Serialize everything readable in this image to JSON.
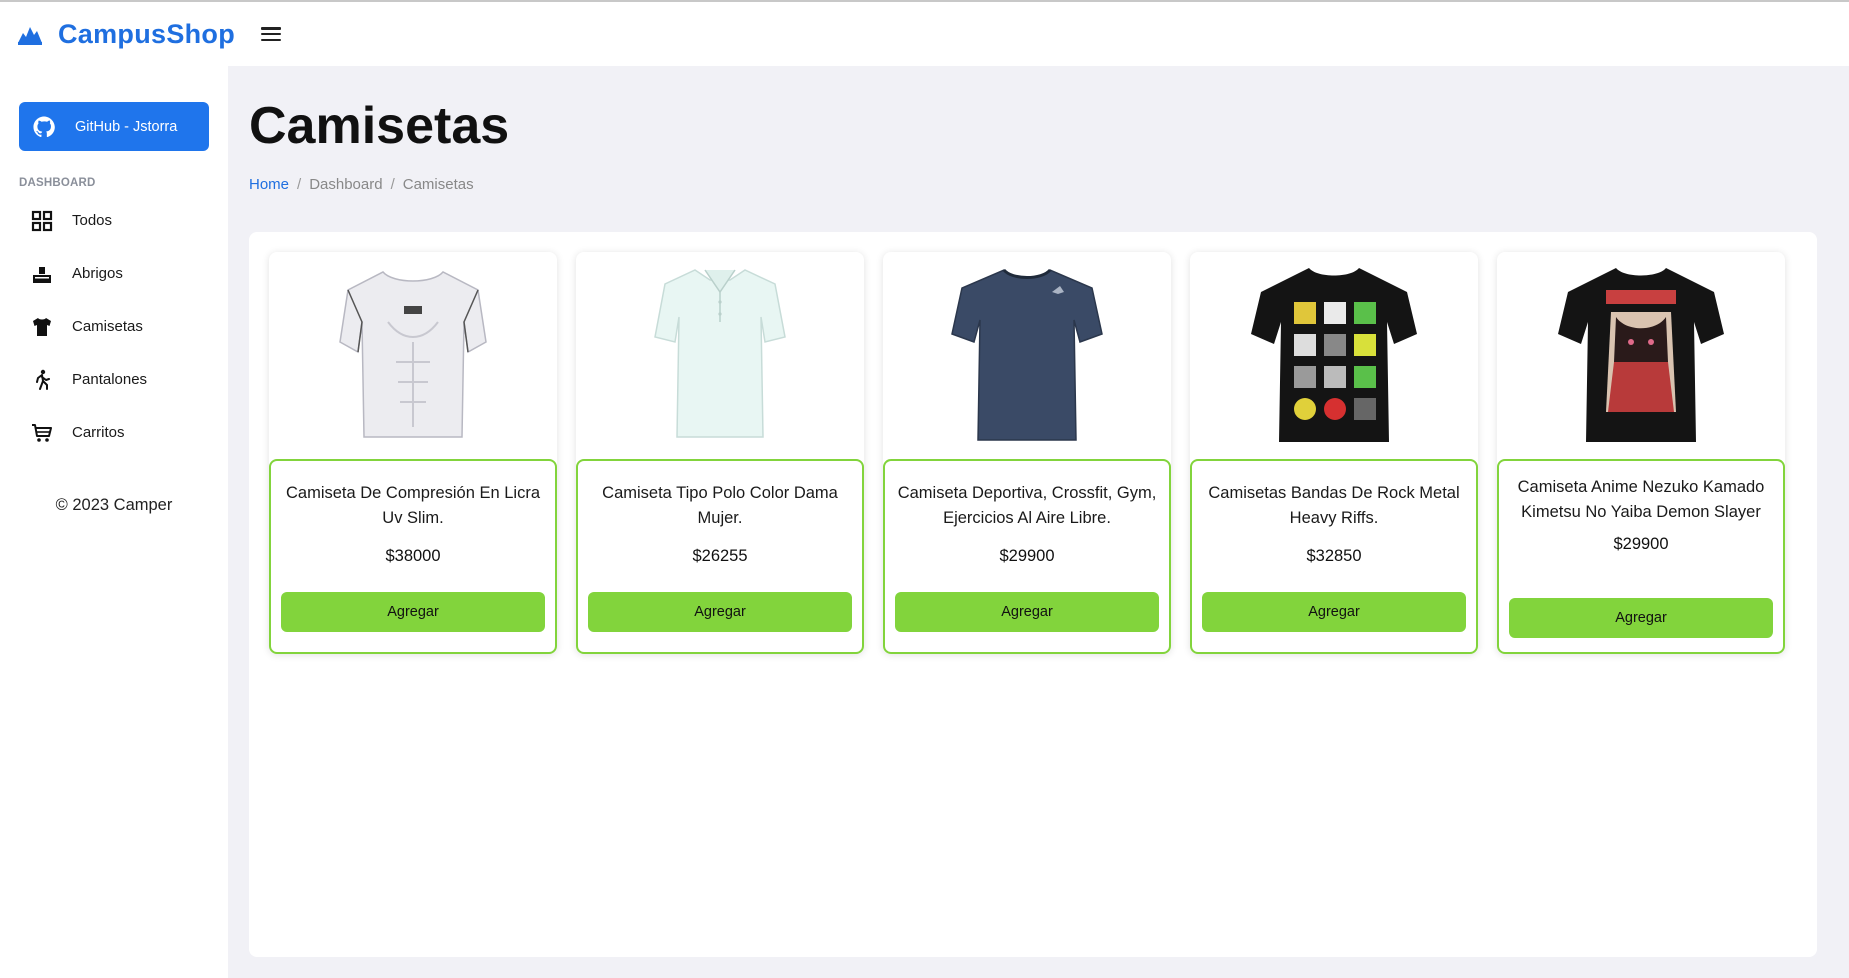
{
  "brand": {
    "name": "CampusShop",
    "logo_icon": "mountain-logo-icon",
    "color": "#1f6fe0"
  },
  "sidebar": {
    "github_button": {
      "label": "GitHub - Jstorra",
      "icon": "github-icon"
    },
    "section_title": "DASHBOARD",
    "items": [
      {
        "label": "Todos",
        "icon": "grid-icon"
      },
      {
        "label": "Abrigos",
        "icon": "box-icon"
      },
      {
        "label": "Camisetas",
        "icon": "tshirt-icon"
      },
      {
        "label": "Pantalones",
        "icon": "walking-icon"
      },
      {
        "label": "Carritos",
        "icon": "cart-icon"
      }
    ],
    "copyright": "© 2023 Camper"
  },
  "main": {
    "title": "Camisetas",
    "breadcrumb": [
      "Home",
      "Dashboard",
      "Camisetas"
    ]
  },
  "products": [
    {
      "title": "Camiseta De Compresión En Licra Uv Slim.",
      "price": "$38000",
      "button": "Agregar",
      "image": "white-compression-shirt"
    },
    {
      "title": "Camiseta Tipo Polo Color Dama Mujer.",
      "price": "$26255",
      "button": "Agregar",
      "image": "mint-polo-shirt"
    },
    {
      "title": "Camiseta Deportiva, Crossfit, Gym, Ejercicios Al Aire Libre.",
      "price": "$29900",
      "button": "Agregar",
      "image": "navy-sport-shirt"
    },
    {
      "title": "Camisetas Bandas De Rock Metal Heavy Riffs.",
      "price": "$32850",
      "button": "Agregar",
      "image": "black-band-shirt"
    },
    {
      "title": "Camiseta Anime Nezuko Kamado Kimetsu No Yaiba Demon Slayer",
      "price": "$29900",
      "button": "Agregar",
      "image": "black-anime-shirt"
    }
  ],
  "colors": {
    "accent": "#1f75ec",
    "card_border": "#82d43c",
    "button": "#82d43c"
  }
}
